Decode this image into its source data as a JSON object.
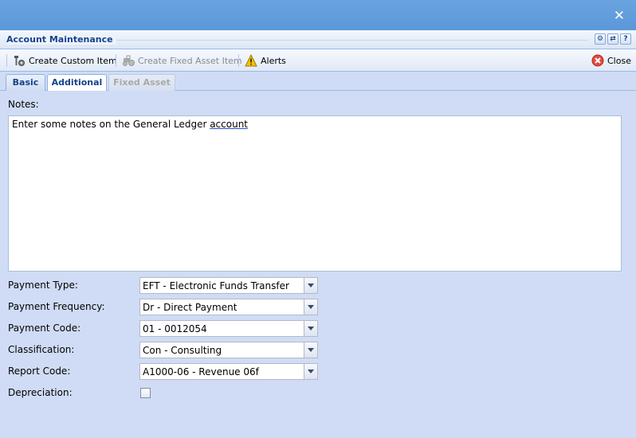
{
  "panel": {
    "title": "Account Maintenance"
  },
  "toolbar": {
    "create_custom_item": "Create Custom Item",
    "create_fixed_asset_item": "Create Fixed Asset Item",
    "alerts": "Alerts",
    "close": "Close"
  },
  "tabs": [
    {
      "label": "Basic"
    },
    {
      "label": "Additional"
    },
    {
      "label": "Fixed Asset"
    }
  ],
  "notes": {
    "label": "Notes:",
    "text_prefix": "Enter some notes on the General Ledger ",
    "text_misspelled": "account"
  },
  "fields": {
    "payment_type": {
      "label": "Payment Type:",
      "value": "EFT - Electronic Funds Transfer"
    },
    "payment_frequency": {
      "label": "Payment Frequency:",
      "value": "Dr - Direct Payment"
    },
    "payment_code": {
      "label": "Payment Code:",
      "value": "01 - 0012054"
    },
    "classification": {
      "label": "Classification:",
      "value": "Con - Consulting"
    },
    "report_code": {
      "label": "Report Code:",
      "value": "A1000-06 - Revenue 06f"
    },
    "depreciation": {
      "label": "Depreciation:",
      "checked": false
    }
  },
  "colors": {
    "title_bar": "#5b98d9",
    "header_text": "#15428b",
    "body_bg": "#d0dcf5"
  }
}
